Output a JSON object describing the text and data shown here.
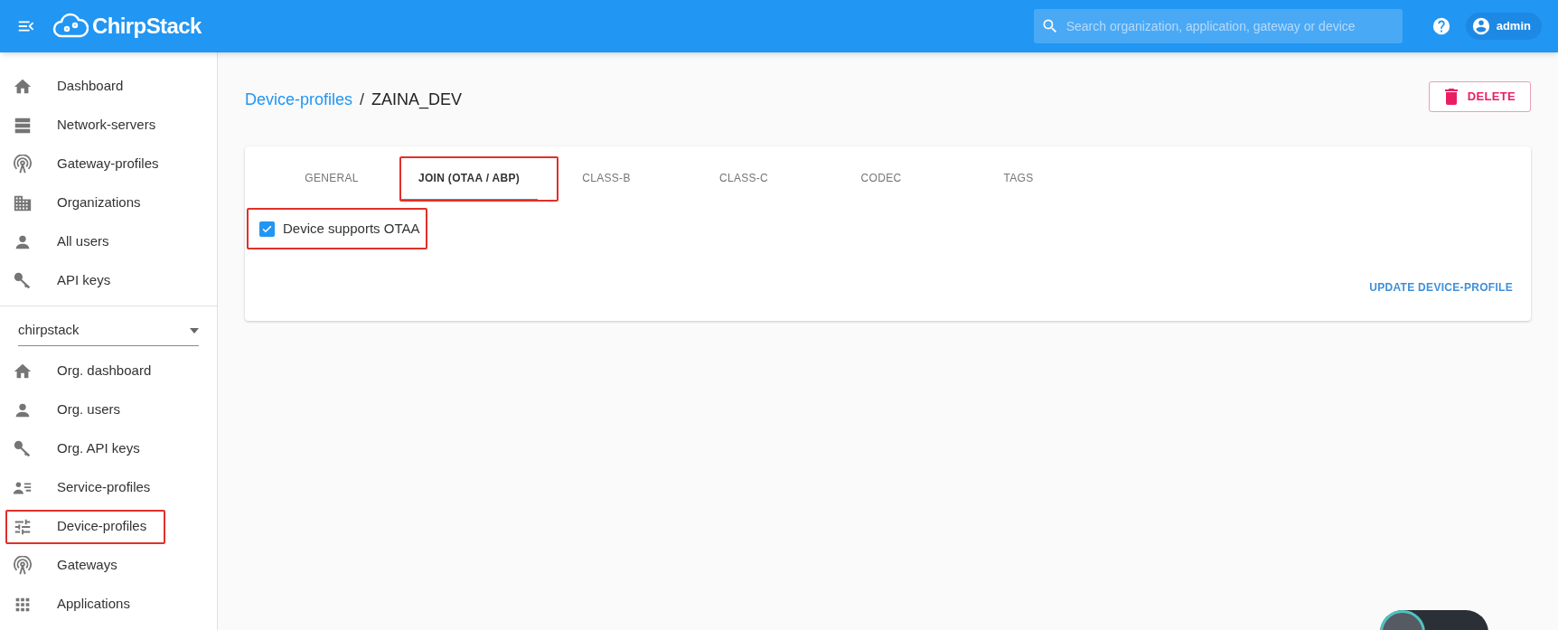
{
  "topbar": {
    "brand": "ChirpStack",
    "search": {
      "placeholder": "Search organization, application, gateway or device"
    },
    "user": "admin"
  },
  "sidebar": {
    "items": [
      {
        "label": "Dashboard",
        "kind": "home",
        "highlighted": false
      },
      {
        "label": "Network-servers",
        "kind": "server",
        "highlighted": false
      },
      {
        "label": "Gateway-profiles",
        "kind": "antenna",
        "highlighted": false
      },
      {
        "label": "Organizations",
        "kind": "building",
        "highlighted": false
      },
      {
        "label": "All users",
        "kind": "person",
        "highlighted": false
      },
      {
        "label": "API keys",
        "kind": "key",
        "highlighted": false
      }
    ],
    "organization_select": {
      "value": "chirpstack"
    },
    "org_items": [
      {
        "label": "Org. dashboard",
        "kind": "home",
        "highlighted": false
      },
      {
        "label": "Org. users",
        "kind": "person",
        "highlighted": false
      },
      {
        "label": "Org. API keys",
        "kind": "key",
        "highlighted": false
      },
      {
        "label": "Service-profiles",
        "kind": "personlist",
        "highlighted": false
      },
      {
        "label": "Device-profiles",
        "kind": "tune",
        "highlighted": true
      },
      {
        "label": "Gateways",
        "kind": "antenna",
        "highlighted": false
      },
      {
        "label": "Applications",
        "kind": "apps",
        "highlighted": false
      }
    ]
  },
  "breadcrumb": {
    "link": "Device-profiles",
    "separator": "/",
    "current": "ZAINA_DEV"
  },
  "delete_button": "DELETE",
  "tabs": [
    {
      "label": "GENERAL",
      "selected": false,
      "highlighted": false
    },
    {
      "label": "JOIN (OTAA / ABP)",
      "selected": true,
      "highlighted": true
    },
    {
      "label": "CLASS-B",
      "selected": false,
      "highlighted": false
    },
    {
      "label": "CLASS-C",
      "selected": false,
      "highlighted": false
    },
    {
      "label": "CODEC",
      "selected": false,
      "highlighted": false
    },
    {
      "label": "TAGS",
      "selected": false,
      "highlighted": false
    }
  ],
  "otaa_checkbox": {
    "label": "Device supports OTAA",
    "checked": true,
    "highlighted": true
  },
  "update_button": "UPDATE DEVICE-PROFILE"
}
